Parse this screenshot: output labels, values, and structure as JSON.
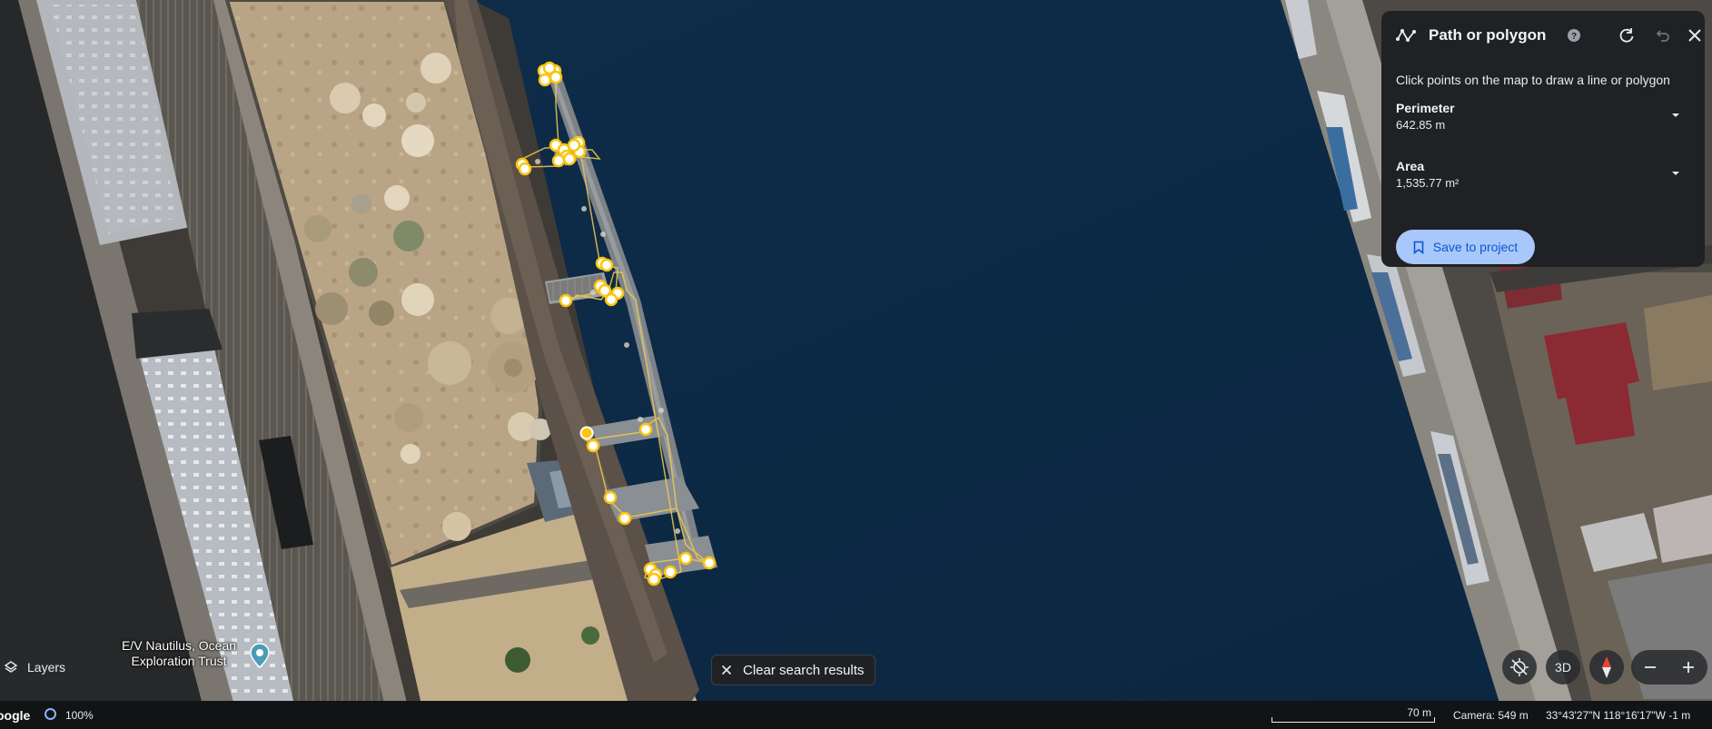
{
  "measure_panel": {
    "title": "Path or polygon",
    "hint": "Click points on the map to draw a line or polygon",
    "metrics": [
      {
        "label": "Perimeter",
        "value": "642.85 m"
      },
      {
        "label": "Area",
        "value": "1,535.77 m²"
      }
    ],
    "save_label": "Save to project"
  },
  "controls": {
    "layers_label": "Layers",
    "clear_label": "Clear search results",
    "three_d_label": "3D"
  },
  "poi": {
    "label_line1": "E/V Nautilus, Ocean",
    "label_line2": "Exploration Trust"
  },
  "status": {
    "brand": "oogle",
    "load_percent": "100%",
    "scale": "70 m",
    "camera": "Camera: 549 m",
    "coordinates": "33°43'27\"N 118°16'17\"W",
    "elevation": "-1 m"
  },
  "colors": {
    "water": "#0d2a44",
    "panel_bg": "#202124",
    "accent": "#a8c7fa",
    "measure_point": "#f9c510"
  },
  "icons": [
    "path-icon",
    "help-icon",
    "redo-icon",
    "undo-icon",
    "close-icon",
    "chevron-down-icon",
    "bookmark-icon",
    "layers-icon",
    "close-small-icon",
    "location-pin-icon",
    "no-gps-icon",
    "compass-icon",
    "zoom-out-icon",
    "zoom-in-icon"
  ]
}
